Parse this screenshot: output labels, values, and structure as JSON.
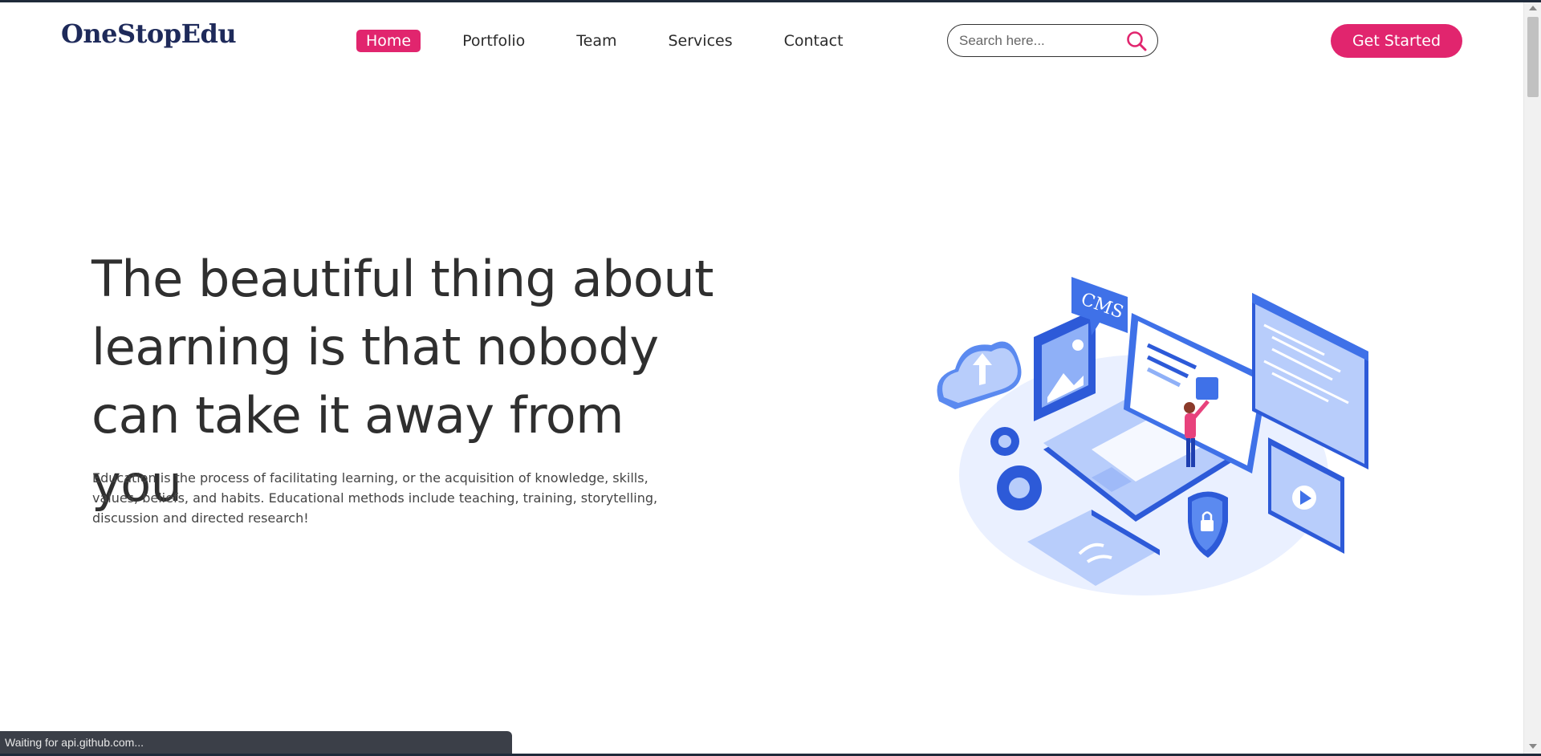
{
  "brand": {
    "name": "OneStopEdu",
    "accent": "#e1256e",
    "logo_color": "#1e2a5a"
  },
  "nav": {
    "items": [
      {
        "label": "Home",
        "active": true
      },
      {
        "label": "Portfolio",
        "active": false
      },
      {
        "label": "Team",
        "active": false
      },
      {
        "label": "Services",
        "active": false
      },
      {
        "label": "Contact",
        "active": false
      }
    ]
  },
  "search": {
    "placeholder": "Search here...",
    "icon": "search-icon"
  },
  "cta": {
    "label": "Get Started"
  },
  "hero": {
    "title": "The beautiful thing about learning is that nobody can take it away from you",
    "description": "Education is the process of facilitating learning, or the acquisition of knowledge, skills, values, beliefs, and habits. Educational methods include teaching, training, storytelling, discussion and directed research!",
    "illustration_badge": "CMS"
  },
  "status_bar": {
    "text": "Waiting for api.github.com..."
  }
}
